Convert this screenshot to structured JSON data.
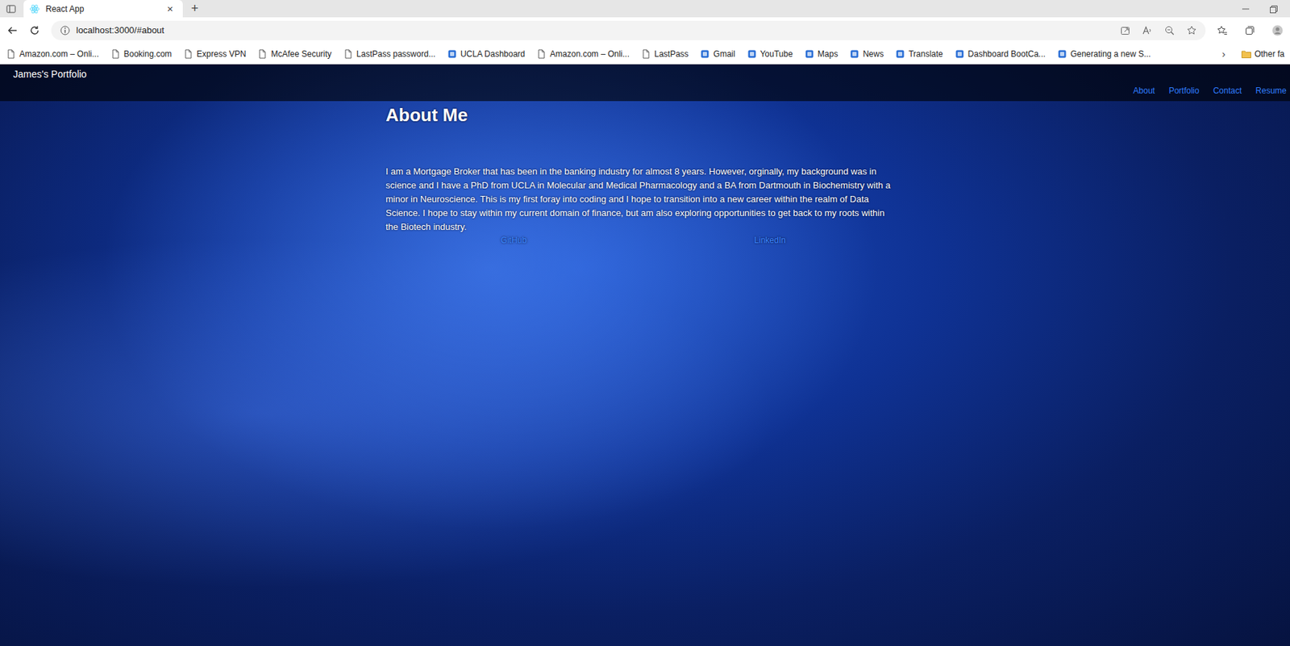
{
  "browser": {
    "tabs": [
      {
        "label": "React App",
        "selected": true
      }
    ],
    "close": "×",
    "new_tab": "+",
    "address": "localhost:3000/#about",
    "bookmarks": [
      {
        "label": "Amazon.com – Onli...",
        "kind": "page"
      },
      {
        "label": "Booking.com",
        "kind": "page"
      },
      {
        "label": "Express VPN",
        "kind": "page"
      },
      {
        "label": "McAfee Security",
        "kind": "page"
      },
      {
        "label": "LastPass password...",
        "kind": "page"
      },
      {
        "label": "UCLA Dashboard",
        "kind": "site"
      },
      {
        "label": "Amazon.com – Onli...",
        "kind": "page"
      },
      {
        "label": "LastPass",
        "kind": "page"
      },
      {
        "label": "Gmail",
        "kind": "site"
      },
      {
        "label": "YouTube",
        "kind": "site"
      },
      {
        "label": "Maps",
        "kind": "site"
      },
      {
        "label": "News",
        "kind": "site"
      },
      {
        "label": "Translate",
        "kind": "site"
      },
      {
        "label": "Dashboard BootCa...",
        "kind": "site"
      },
      {
        "label": "Generating a new S...",
        "kind": "site"
      }
    ],
    "more": "›",
    "other": "Other fa"
  },
  "page": {
    "brand": "James's Portfolio",
    "nav": [
      "About",
      "Portfolio",
      "Contact",
      "Resume"
    ],
    "heading": "About Me",
    "paragraph": "I am a Mortgage Broker that has been in the banking industry for almost 8 years. However, orginally, my background was in science and I have a PhD from UCLA in Molecular and Medical Pharmacology and a BA from Dartmouth in Biochemistry with a minor in Neuroscience. This is my first foray into coding and I hope to transition into a new career within the realm of Data Science. I hope to stay within my current domain of finance, but am also exploring opportunities to get back to my roots within the Biotech industry.",
    "links": [
      "GitHub",
      "LinkedIn"
    ]
  }
}
